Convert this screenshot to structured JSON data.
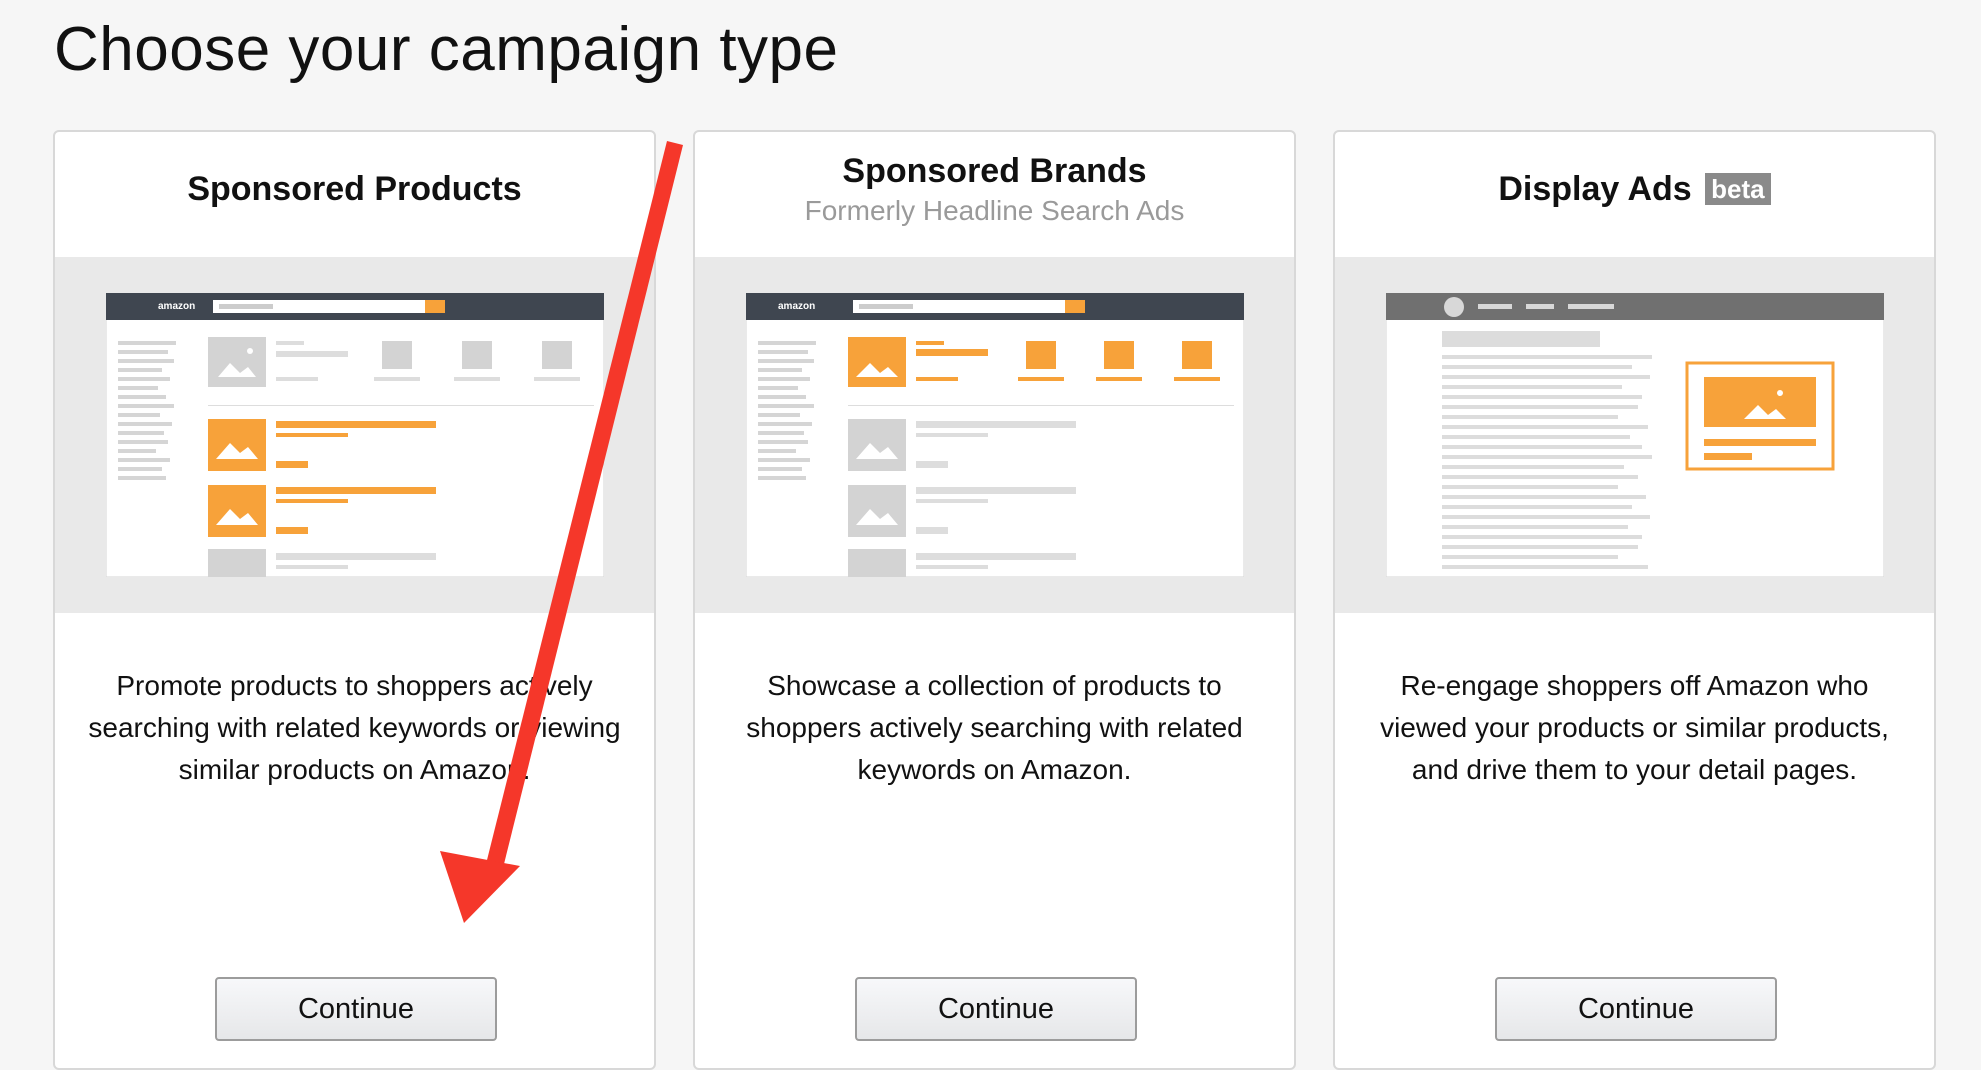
{
  "page": {
    "title": "Choose your campaign type"
  },
  "cards": [
    {
      "title": "Sponsored Products",
      "subtitle": "",
      "badge": "",
      "preview_logo": "amazon",
      "description": "Promote products to shoppers actively searching with related keywords or viewing similar products on Amazon.",
      "button_label": "Continue"
    },
    {
      "title": "Sponsored Brands",
      "subtitle": "Formerly Headline Search Ads",
      "badge": "",
      "preview_logo": "amazon",
      "description": "Showcase a collection of products to shoppers actively searching with related keywords on Amazon.",
      "button_label": "Continue"
    },
    {
      "title": "Display Ads",
      "subtitle": "",
      "badge": "beta",
      "description": "Re-engage shoppers off Amazon who viewed your products or similar products, and drive them to your detail pages.",
      "button_label": "Continue"
    }
  ],
  "colors": {
    "accent_orange": "#f7a23a",
    "annotation_arrow": "#f5372a",
    "badge_gray": "#8a8a8a"
  }
}
